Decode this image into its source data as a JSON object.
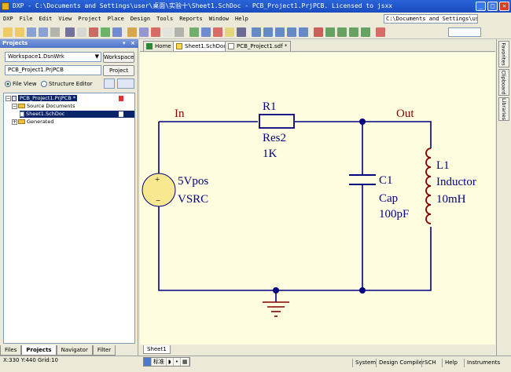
{
  "window": {
    "title": "DXP - C:\\Documents and Settings\\user\\桌面\\实验十\\Sheet1.SchDoc - PCB_Project1.PrjPCB. Licensed to jsxx"
  },
  "menu": {
    "items": [
      {
        "label": "DXP"
      },
      {
        "label": "File"
      },
      {
        "label": "Edit"
      },
      {
        "label": "View"
      },
      {
        "label": "Project"
      },
      {
        "label": "Place"
      },
      {
        "label": "Design"
      },
      {
        "label": "Tools"
      },
      {
        "label": "Reports"
      },
      {
        "label": "Window"
      },
      {
        "label": "Help"
      }
    ],
    "path_value": "C:\\Documents and Settings\\user\\"
  },
  "projects_panel": {
    "title": "Projects",
    "workspace_value": "Workspace1.DsnWrk",
    "workspace_button": "Workspace",
    "project_value": "PCB_Project1.PrjPCB",
    "project_button": "Project",
    "file_view_label": "File View",
    "structure_editor_label": "Structure Editor",
    "tree": {
      "project": "PCB_Project1.PrjPCB *",
      "source_folder": "Source Documents",
      "sheet": "Sheet1.SchDoc",
      "generated_folder": "Generated"
    },
    "bottom_tabs": [
      "Files",
      "Projects",
      "Navigator",
      "Filter"
    ]
  },
  "doc_tabs": {
    "home": "Home",
    "sheet": "Sheet1.SchDoc",
    "pcb": "PCB_Project1.sdf *"
  },
  "right_tabs": [
    "Favorites",
    "Clipboard",
    "Libraries"
  ],
  "schematic": {
    "net_in": "In",
    "net_out": "Out",
    "r1": {
      "designator": "R1",
      "comment": "Res2",
      "value": "1K"
    },
    "source": {
      "value": "5Vpos",
      "type": "VSRC"
    },
    "c1": {
      "designator": "C1",
      "comment": "Cap",
      "value": "100pF"
    },
    "l1": {
      "designator": "L1",
      "comment": "Inductor",
      "value": "10mH"
    }
  },
  "sheet_tab": "Sheet1",
  "status": {
    "coords": "X:330 Y:440",
    "grid": "Grid:10",
    "ime_label": "标准",
    "buttons": [
      "System",
      "Design Compiler",
      "SCH",
      "Help",
      "Instruments"
    ]
  },
  "colors": {
    "wire": "#000080",
    "component": "#800000",
    "junction": "#000080",
    "source_fill": "#f8e890",
    "canvas": "#fffde0",
    "ground": "#800000"
  }
}
